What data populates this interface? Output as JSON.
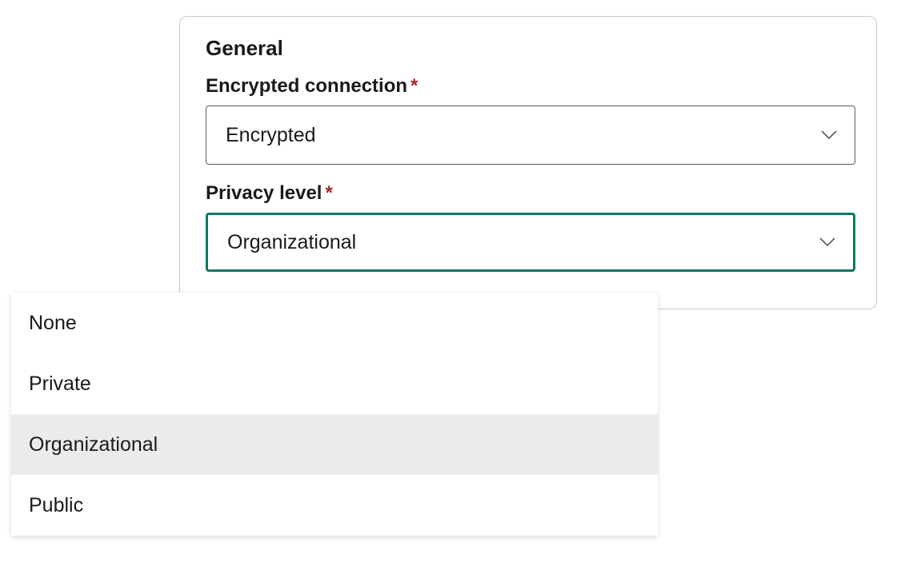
{
  "panel": {
    "section_title": "General",
    "encrypted_connection": {
      "label": "Encrypted connection",
      "required_marker": "*",
      "value": "Encrypted"
    },
    "privacy_level": {
      "label": "Privacy level",
      "required_marker": "*",
      "value": "Organizational",
      "options": [
        "None",
        "Private",
        "Organizational",
        "Public"
      ],
      "selected_index": 2
    }
  },
  "colors": {
    "accent": "#0f7864",
    "required": "#a4262c",
    "text": "#1a1a1a",
    "border": "#5a5a5a",
    "option_selected_bg": "#edebe9"
  }
}
